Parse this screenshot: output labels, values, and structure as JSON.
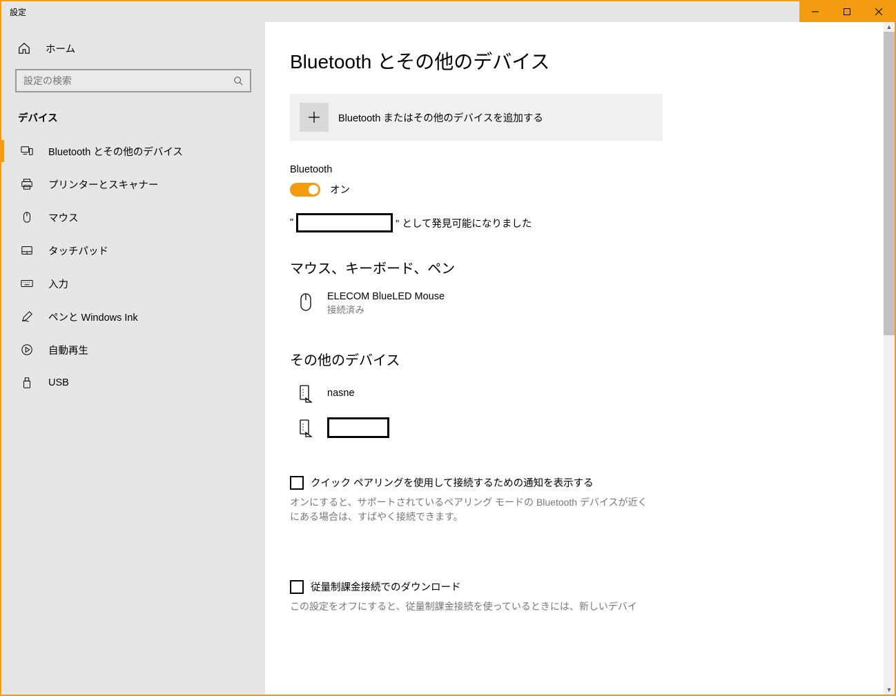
{
  "window": {
    "title": "設定"
  },
  "sidebar": {
    "home": "ホーム",
    "search_placeholder": "設定の検索",
    "category": "デバイス",
    "items": [
      {
        "label": "Bluetooth とその他のデバイス"
      },
      {
        "label": "プリンターとスキャナー"
      },
      {
        "label": "マウス"
      },
      {
        "label": "タッチパッド"
      },
      {
        "label": "入力"
      },
      {
        "label": "ペンと Windows Ink"
      },
      {
        "label": "自動再生"
      },
      {
        "label": "USB"
      }
    ]
  },
  "page": {
    "title": "Bluetooth とその他のデバイス",
    "add_device": "Bluetooth またはその他のデバイスを追加する",
    "bluetooth_label": "Bluetooth",
    "toggle_state": "オン",
    "discoverable_prefix": "\"",
    "discoverable_suffix": "\" として発見可能になりました",
    "group_mkp": "マウス、キーボード、ペン",
    "device1_name": "ELECOM BlueLED Mouse",
    "device1_status": "接続済み",
    "group_other": "その他のデバイス",
    "other1_name": "nasne",
    "quick_pairing_label": "クイック ペアリングを使用して接続するための通知を表示する",
    "quick_pairing_desc": "オンにすると、サポートされているペアリング モードの Bluetooth デバイスが近くにある場合は、すばやく接続できます。",
    "metered_label": "従量制課金接続でのダウンロード",
    "metered_desc": "この設定をオフにすると、従量制課金接続を使っているときには、新しいデバイ"
  }
}
